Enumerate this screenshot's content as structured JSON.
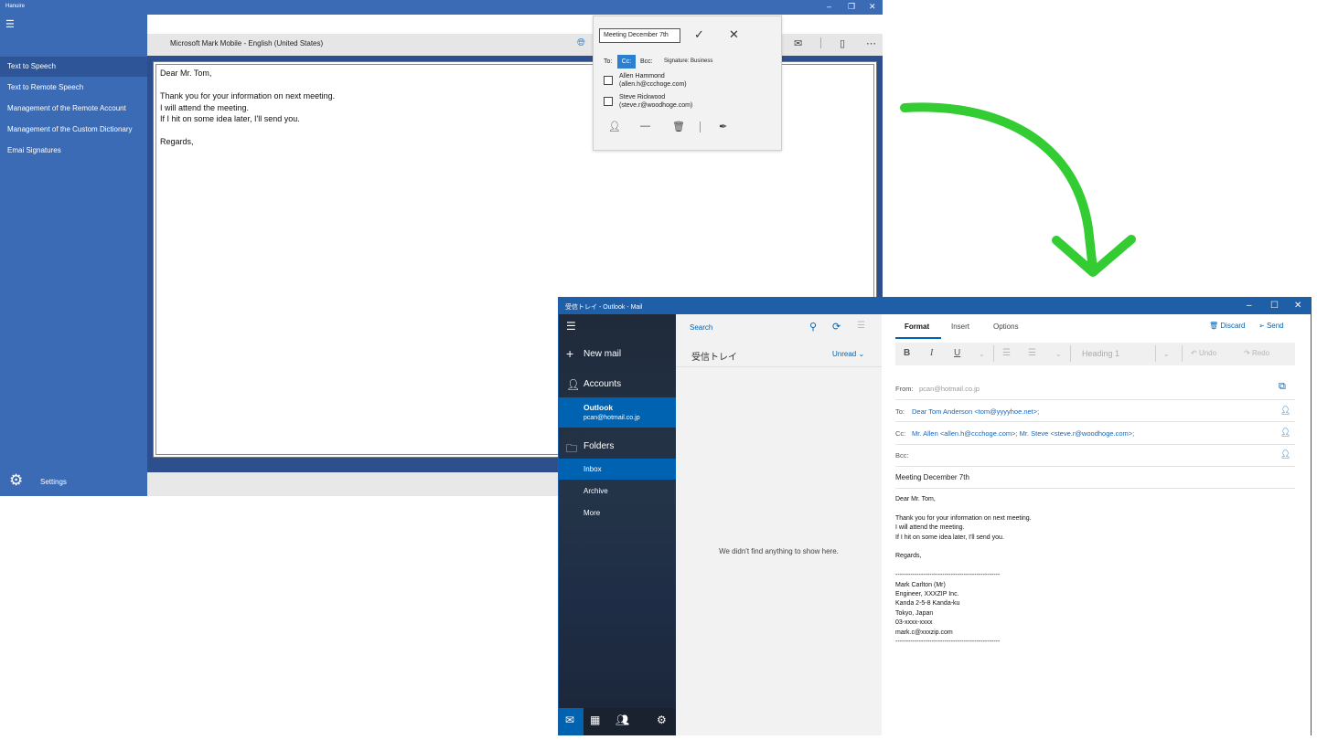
{
  "hanuire": {
    "title": "Hanuire",
    "nav": [
      "Text to Speech",
      "Text to Remote Speech",
      "Management of the Remote Account",
      "Management of the Custom Dictionary",
      "Emai Signatures"
    ],
    "settings_label": "Settings",
    "voice": "Microsoft Mark Mobile - English (United States)",
    "editor_lines": {
      "greeting": "Dear Mr. Tom,",
      "line1": "Thank you for your information on next meeting.",
      "line2": "I will attend the meeting.",
      "line3": "If I hit on some idea later, I'll send you.",
      "closing": "Regards,"
    },
    "popup": {
      "subject": "Meeting December 7th",
      "to_label": "To:",
      "cc_label": "Cc:",
      "bcc_label": "Bcc:",
      "signature_label": "Signature: Business",
      "contacts": [
        {
          "name": "Allen Hammond",
          "email": "(allen.h@ccchoge.com)"
        },
        {
          "name": "Steve Rickwood",
          "email": "(steve.r@woodhoge.com)"
        }
      ]
    }
  },
  "mail": {
    "title": "受信トレイ - Outlook - Mail",
    "sidebar": {
      "new_mail": "New mail",
      "accounts": "Accounts",
      "account_name": "Outlook",
      "account_email": "pcan@hotmail.co.jp",
      "folders": "Folders",
      "folder_items": [
        "Inbox",
        "Archive",
        "More"
      ]
    },
    "list": {
      "search": "Search",
      "folder_title": "受信トレイ",
      "filter": "Unread",
      "empty_message": "We didn't find anything to show here."
    },
    "compose": {
      "tabs": [
        "Format",
        "Insert",
        "Options"
      ],
      "discard": "Discard",
      "send": "Send",
      "heading_style": "Heading 1",
      "undo": "Undo",
      "redo": "Redo",
      "from_label": "From:",
      "from_value": "pcan@hotmail.co.jp",
      "to_label": "To:",
      "to_value": "Dear Tom  Anderson <tom@yyyyhoe.net>;",
      "cc_label": "Cc:",
      "cc_value": "Mr. Allen <allen.h@ccchoge.com>; Mr. Steve <steve.r@woodhoge.com>;",
      "bcc_label": "Bcc:",
      "subject": "Meeting December 7th",
      "body": {
        "greeting": "Dear Mr. Tom,",
        "line1": "Thank you for your information on next meeting.",
        "line2": "I will attend the meeting.",
        "line3": "If I hit on some idea later, I'll send you.",
        "closing": "Regards,",
        "sig_rule": "-------------------------------------------------",
        "sig_name": "Mark Carlton (Mr)",
        "sig_title": "Engineer, XXXZIP Inc.",
        "sig_addr1": "Kanda 2-5-8 Kanda-ku",
        "sig_addr2": "Tokyo, Japan",
        "sig_phone": "03-xxxx-xxxx",
        "sig_email": "mark.c@xxxzip.com"
      }
    }
  },
  "colors": {
    "hanuire_blue": "#3b6bb5",
    "mail_blue": "#0063b1",
    "arrow_green": "#33cc33"
  }
}
